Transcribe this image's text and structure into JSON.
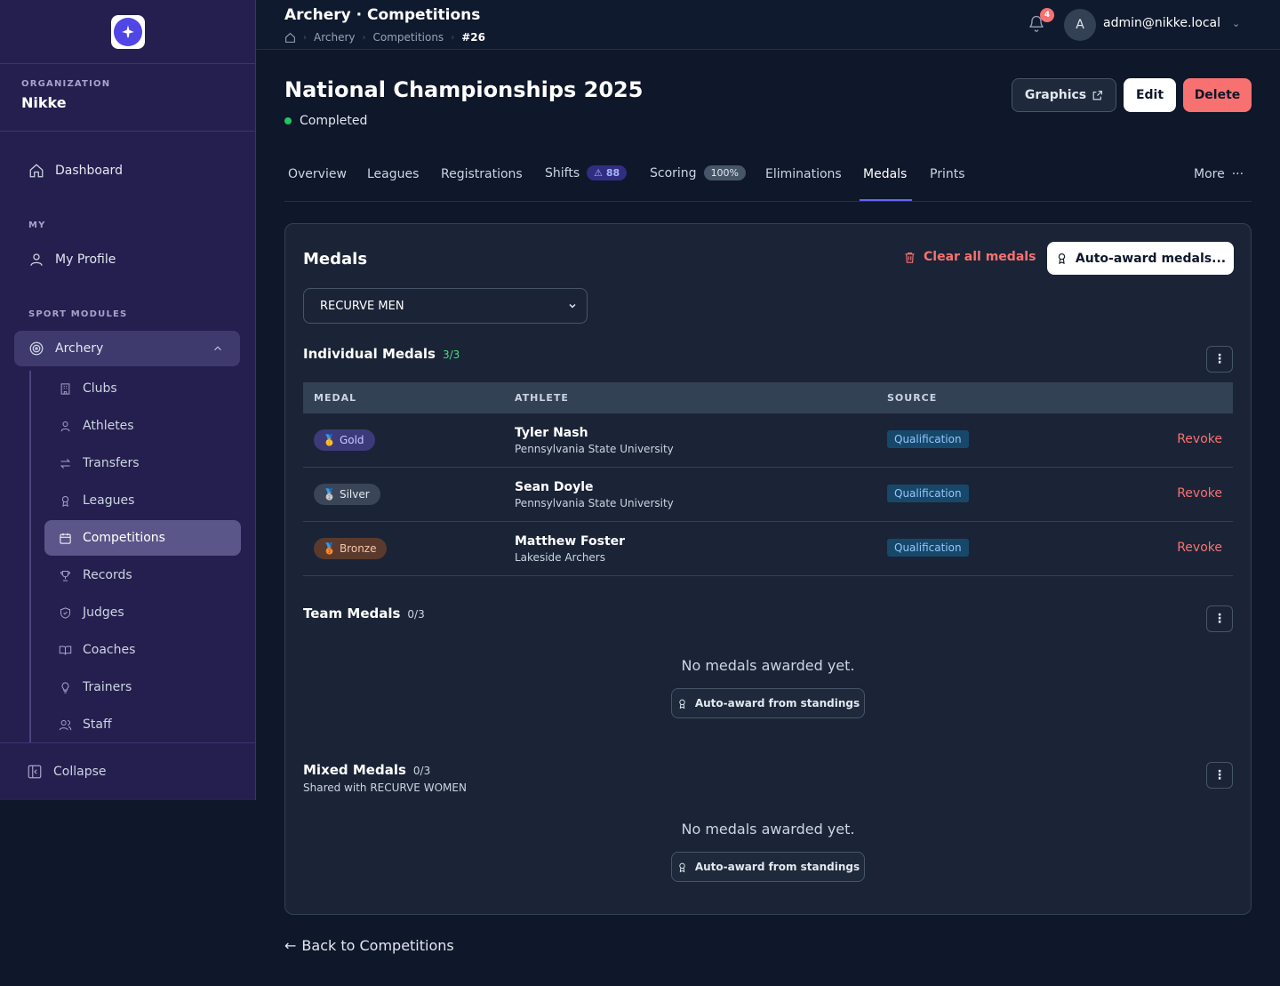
{
  "sidebar": {
    "org_label": "ORGANIZATION",
    "org_name": "Nikke",
    "dashboard": "Dashboard",
    "my_label": "MY",
    "my_profile": "My Profile",
    "sport_label": "SPORT MODULES",
    "archery": "Archery",
    "sub_items": [
      "Clubs",
      "Athletes",
      "Transfers",
      "Leagues",
      "Competitions",
      "Records",
      "Judges",
      "Coaches",
      "Trainers",
      "Staff"
    ],
    "active_sub": "Competitions",
    "collapse": "Collapse"
  },
  "header": {
    "title": "Archery · Competitions",
    "breadcrumb": [
      "Archery",
      "Competitions",
      "#26"
    ],
    "notifications": "4",
    "avatar_initial": "A",
    "user": "admin@nikke.local"
  },
  "page": {
    "title": "National Championships 2025",
    "status": "Completed",
    "status_color": "#22c55e",
    "graphics": "Graphics",
    "edit": "Edit",
    "delete": "Delete"
  },
  "tabs": {
    "overview": "Overview",
    "leagues": "Leagues",
    "registrations": "Registrations",
    "shifts": "Shifts",
    "shifts_badge": "88",
    "scoring": "Scoring",
    "scoring_badge": "100%",
    "eliminations": "Eliminations",
    "medals": "Medals",
    "prints": "Prints",
    "more": "More",
    "active": "Medals"
  },
  "medals": {
    "title": "Medals",
    "clear_all": "Clear all medals",
    "auto_award": "Auto-award medals...",
    "category_selected": "RECURVE MEN",
    "individual": {
      "title": "Individual Medals",
      "count": "3/3",
      "headers": [
        "MEDAL",
        "ATHLETE",
        "SOURCE"
      ],
      "rows": [
        {
          "medal": "Gold",
          "athlete": "Tyler Nash",
          "club": "Pennsylvania State University",
          "source": "Qualification",
          "action": "Revoke"
        },
        {
          "medal": "Silver",
          "athlete": "Sean Doyle",
          "club": "Pennsylvania State University",
          "source": "Qualification",
          "action": "Revoke"
        },
        {
          "medal": "Bronze",
          "athlete": "Matthew Foster",
          "club": "Lakeside Archers",
          "source": "Qualification",
          "action": "Revoke"
        }
      ]
    },
    "team": {
      "title": "Team Medals",
      "count": "0/3",
      "empty": "No medals awarded yet.",
      "auto": "Auto-award from standings"
    },
    "mixed": {
      "title": "Mixed Medals",
      "count": "0/3",
      "subtitle": "Shared with RECURVE WOMEN",
      "empty": "No medals awarded yet.",
      "auto": "Auto-award from standings"
    }
  },
  "footer": {
    "back": "Back to Competitions"
  },
  "colors": {
    "accent": "#6366f1",
    "danger": "#f87171",
    "success": "#4ade80"
  }
}
